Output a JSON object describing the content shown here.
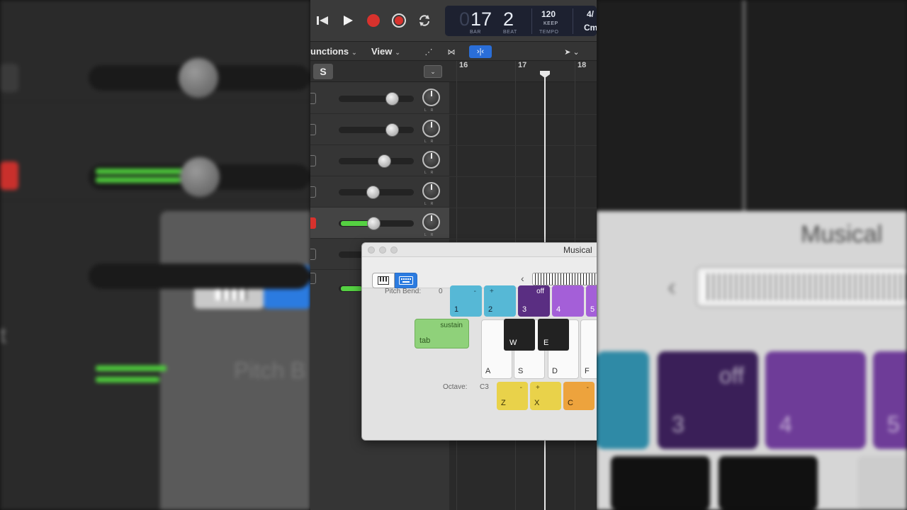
{
  "transport": {
    "bar": "17",
    "beat": "2",
    "bar_ghost": "0",
    "bar_label": "BAR",
    "beat_label": "BEAT",
    "tempo": "120",
    "tempo_mode": "KEEP",
    "tempo_label": "TEMPO",
    "signature": "4/",
    "key": "Cm"
  },
  "menubar": {
    "functions": "unctions",
    "view": "View"
  },
  "mixer": {
    "solo_label": "S"
  },
  "ruler": {
    "bars": [
      "16",
      "17",
      "18"
    ]
  },
  "musical_typing": {
    "title": "Musical",
    "pitch_bend_label": "Pitch Bend:",
    "pitch_bend_value": "0",
    "octave_label": "Octave:",
    "octave_value": "C3",
    "sustain_top": "sustain",
    "sustain_key": "tab",
    "number_keys": [
      {
        "key": "1",
        "top": "-"
      },
      {
        "key": "2",
        "top": "+"
      },
      {
        "key": "3",
        "top": "off"
      },
      {
        "key": "4",
        "top": ""
      },
      {
        "key": "5",
        "top": ""
      }
    ],
    "white_keys": [
      "A",
      "S",
      "D",
      "F"
    ],
    "black_keys": [
      "W",
      "E"
    ],
    "octave_keys": [
      {
        "key": "Z",
        "top": "-"
      },
      {
        "key": "X",
        "top": "+"
      },
      {
        "key": "C",
        "top": "-"
      }
    ]
  },
  "background": {
    "left_t": "t",
    "left_pitch": "Pitch B",
    "right_title": "Musical",
    "right_off": "off",
    "right_3": "3",
    "right_4": "4",
    "right_5": "5"
  },
  "colors": {
    "cyan_key": "#56b8d6",
    "purple_dark": "#5a2e82",
    "purple_light": "#a45fd8",
    "green_sustain": "#8fd17a",
    "yellow_key": "#e9d24a",
    "orange_key": "#eda33d",
    "record_red": "#d8322d",
    "meter_green": "#55d142"
  }
}
